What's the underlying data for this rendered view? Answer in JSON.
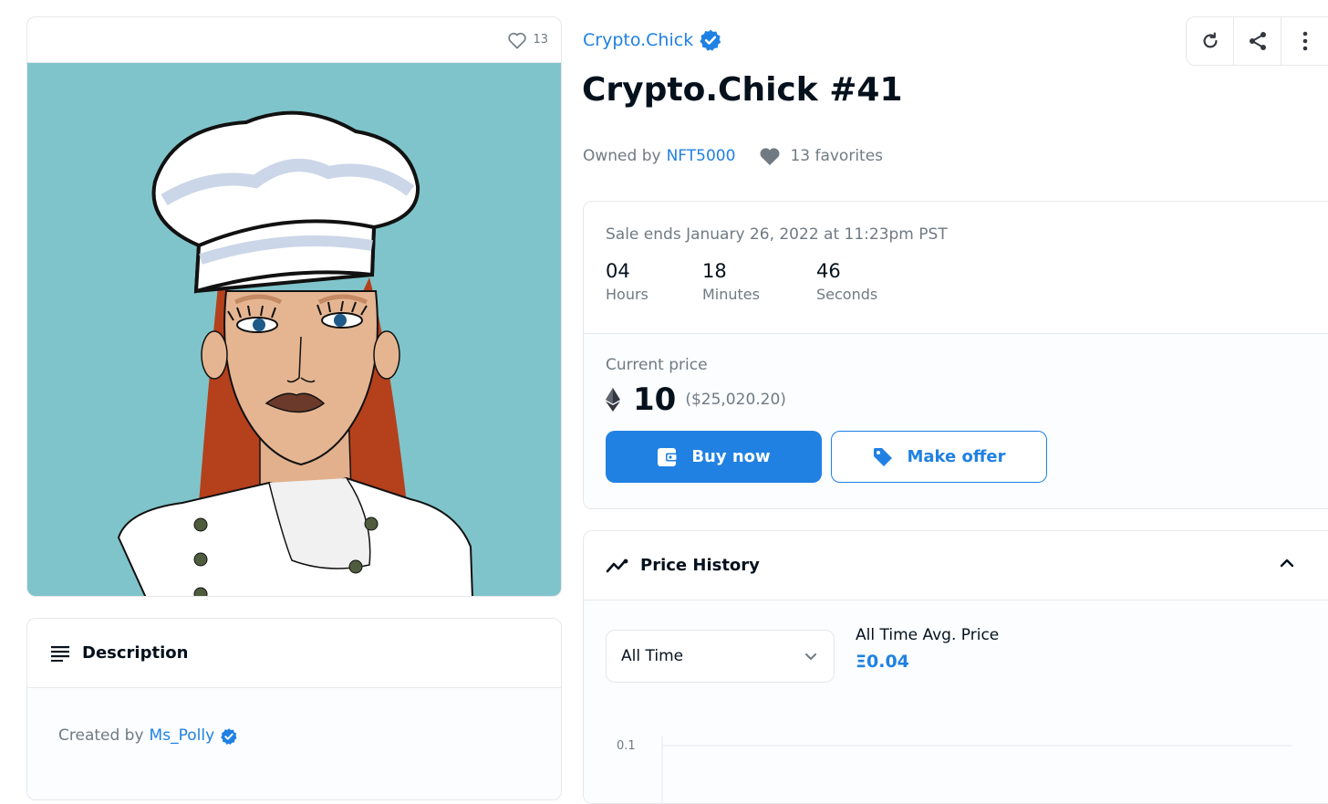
{
  "image_card": {
    "favorite_count": "13"
  },
  "description": {
    "title": "Description",
    "created_by_label": "Created by",
    "creator": "Ms_Polly"
  },
  "collection": {
    "name": "Crypto.Chick"
  },
  "item": {
    "title": "Crypto.Chick #41",
    "owned_by_label": "Owned by",
    "owner": "NFT5000",
    "favorites_text": "13 favorites"
  },
  "toolbar": {
    "icons": [
      "refresh-icon",
      "share-icon",
      "more-icon"
    ]
  },
  "sale": {
    "ends_text": "Sale ends January 26, 2022 at 11:23pm PST",
    "countdown": [
      {
        "value": "04",
        "label": "Hours"
      },
      {
        "value": "18",
        "label": "Minutes"
      },
      {
        "value": "46",
        "label": "Seconds"
      }
    ],
    "current_price_label": "Current price",
    "price": "10",
    "fiat_price": "($25,020.20)",
    "buy_label": "Buy now",
    "offer_label": "Make offer"
  },
  "price_history": {
    "title": "Price History",
    "range_selected": "All Time",
    "avg_label": "All Time Avg. Price",
    "avg_value": "Ξ0.04",
    "y_tick": "0.1"
  },
  "colors": {
    "accent": "#2081e2",
    "art_background": "#7fc4ca",
    "hair": "#b5401c",
    "hat": "#c5d2e6"
  }
}
